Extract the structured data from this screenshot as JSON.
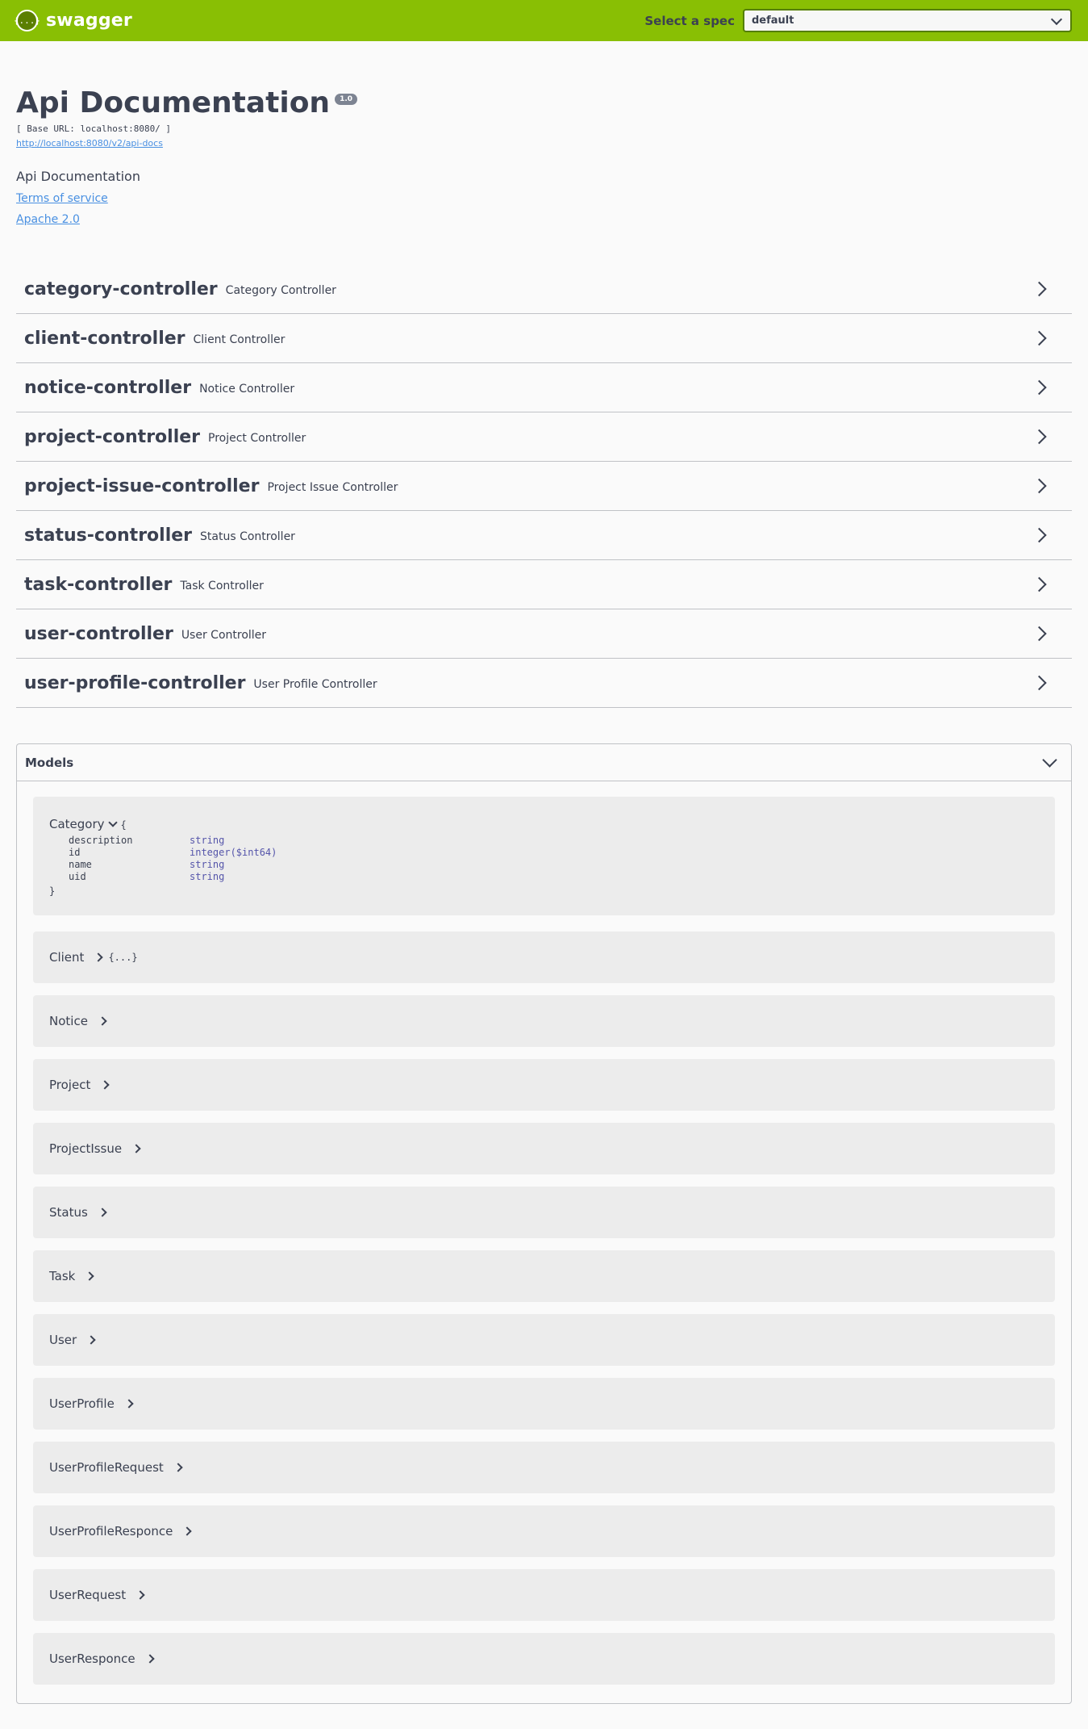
{
  "topbar": {
    "logo_glyph": "{...}",
    "brand": "swagger",
    "spec_label": "Select a spec",
    "spec_value": "default",
    "color": "#89bf04"
  },
  "info": {
    "title": "Api Documentation",
    "version": "1.0",
    "base_url": "[ Base URL: localhost:8080/ ]",
    "api_docs_link": "http://localhost:8080/v2/api-docs",
    "description": "Api Documentation",
    "terms_link": "Terms of service",
    "license_link": "Apache 2.0"
  },
  "controllers": [
    {
      "name": "category-controller",
      "description": "Category Controller"
    },
    {
      "name": "client-controller",
      "description": "Client Controller"
    },
    {
      "name": "notice-controller",
      "description": "Notice Controller"
    },
    {
      "name": "project-controller",
      "description": "Project Controller"
    },
    {
      "name": "project-issue-controller",
      "description": "Project Issue Controller"
    },
    {
      "name": "status-controller",
      "description": "Status Controller"
    },
    {
      "name": "task-controller",
      "description": "Task Controller"
    },
    {
      "name": "user-controller",
      "description": "User Controller"
    },
    {
      "name": "user-profile-controller",
      "description": "User Profile Controller"
    }
  ],
  "models": {
    "title": "Models",
    "category": {
      "name": "Category",
      "open_brace": "{",
      "close_brace": "}",
      "properties": [
        {
          "name": "description",
          "type": "string"
        },
        {
          "name": "id",
          "type": "integer($int64)"
        },
        {
          "name": "name",
          "type": "string"
        },
        {
          "name": "uid",
          "type": "string"
        }
      ]
    },
    "client": {
      "name": "Client",
      "collapsed_hint": "{...}"
    },
    "others": [
      "Notice",
      "Project",
      "ProjectIssue",
      "Status",
      "Task",
      "User",
      "UserProfile",
      "UserProfileRequest",
      "UserProfileResponce",
      "UserRequest",
      "UserResponce"
    ]
  }
}
